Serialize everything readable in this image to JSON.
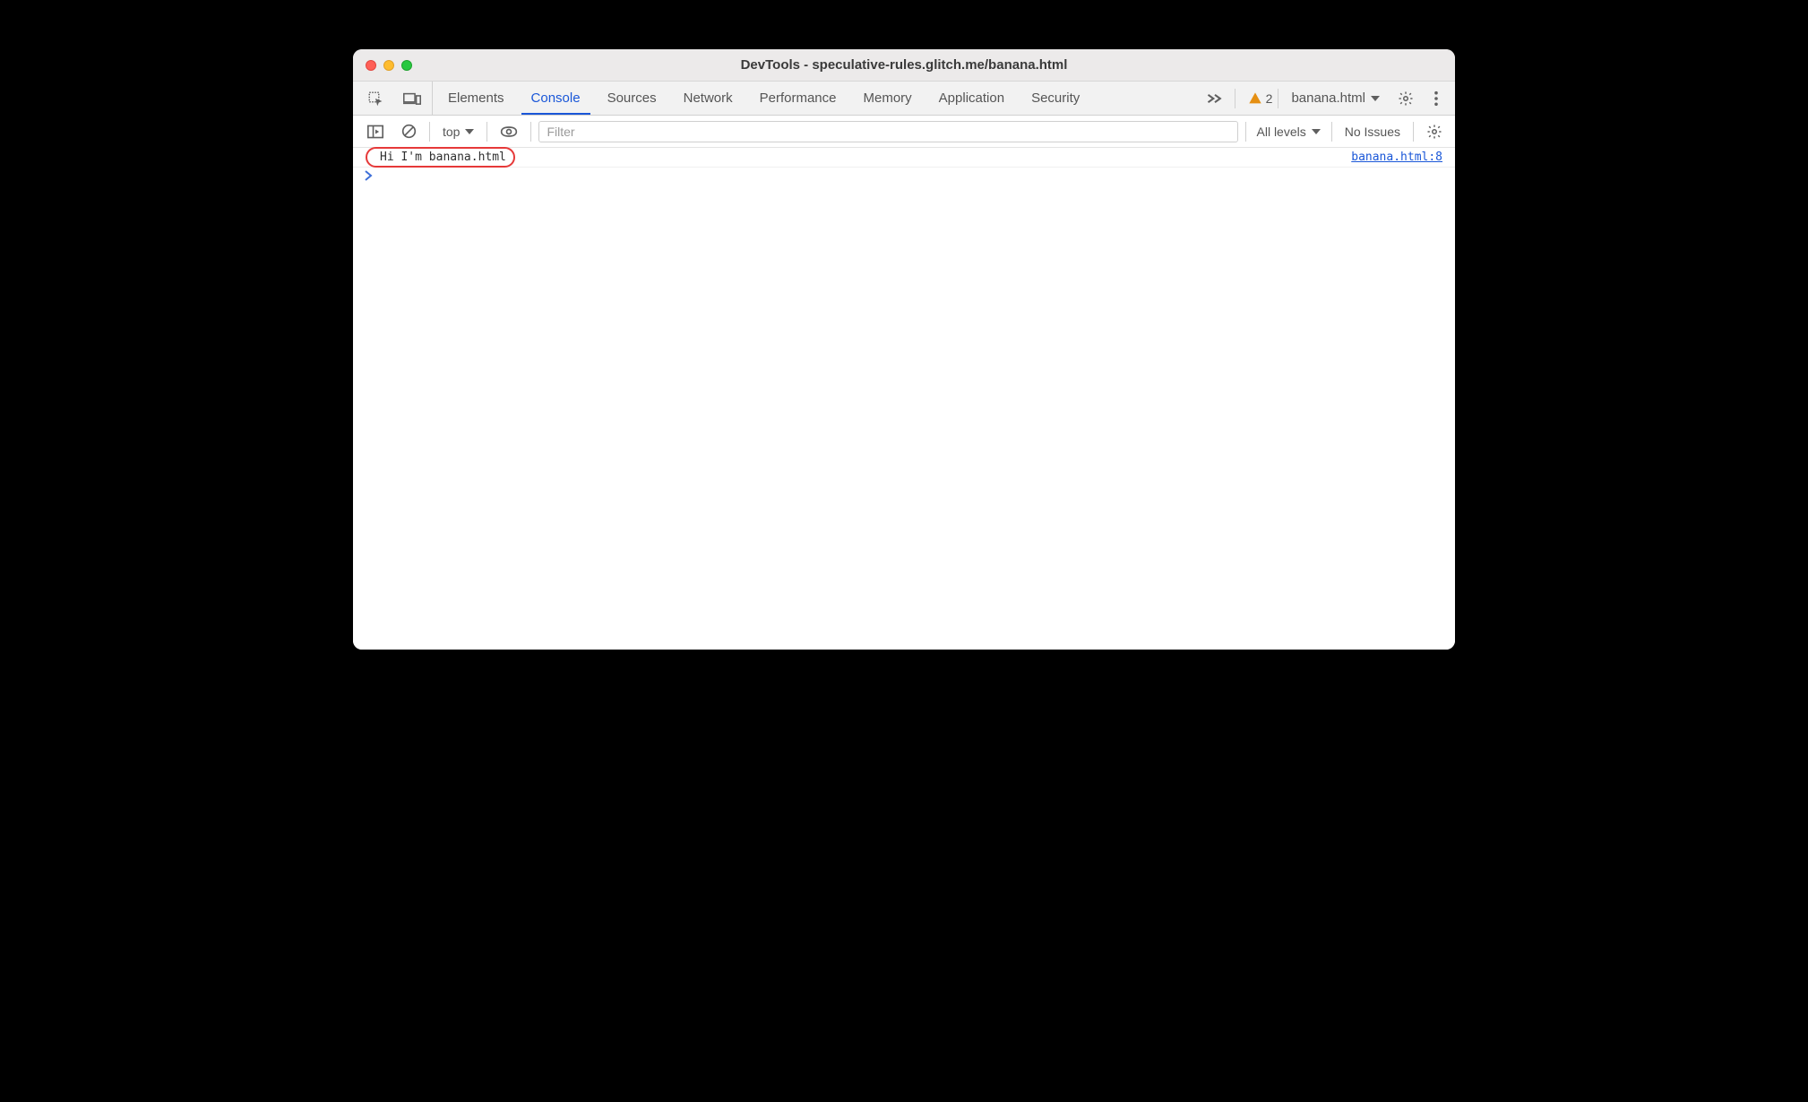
{
  "window": {
    "title": "DevTools - speculative-rules.glitch.me/banana.html"
  },
  "tabs": {
    "items": [
      {
        "label": "Elements"
      },
      {
        "label": "Console"
      },
      {
        "label": "Sources"
      },
      {
        "label": "Network"
      },
      {
        "label": "Performance"
      },
      {
        "label": "Memory"
      },
      {
        "label": "Application"
      },
      {
        "label": "Security"
      }
    ],
    "active_index": 1,
    "warning_count": "2",
    "target_label": "banana.html"
  },
  "filterbar": {
    "context_label": "top",
    "filter_placeholder": "Filter",
    "levels_label": "All levels",
    "issues_label": "No Issues"
  },
  "console": {
    "rows": [
      {
        "message": "Hi I'm banana.html",
        "source": "banana.html:8",
        "highlighted": true
      }
    ]
  }
}
